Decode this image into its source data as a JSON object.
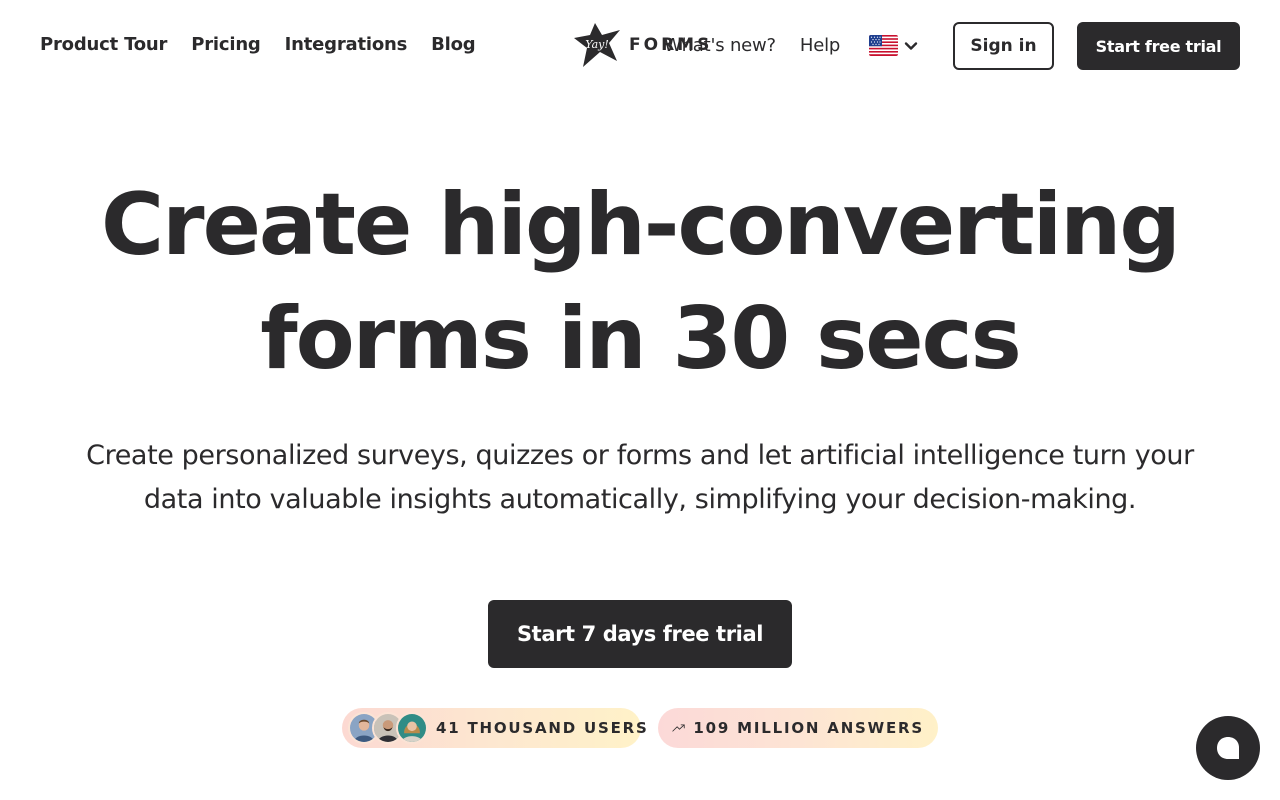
{
  "nav": {
    "left": [
      {
        "label": "Product Tour"
      },
      {
        "label": "Pricing"
      },
      {
        "label": "Integrations"
      },
      {
        "label": "Blog"
      }
    ],
    "logo": {
      "mark_text": "Yay!",
      "word": "FORMS"
    },
    "mid": [
      {
        "label": "What's new?"
      },
      {
        "label": "Help"
      }
    ],
    "language": {
      "flag": "us-flag-icon"
    },
    "sign_in": "Sign in",
    "start_trial": "Start free trial"
  },
  "hero": {
    "title_line1": "Create high-converting",
    "title_line2": "forms in 30 secs",
    "subtitle_line1": "Create personalized surveys, quizzes or forms and let artificial intelligence turn your",
    "subtitle_line2": "data into valuable insights automatically, simplifying your decision-making.",
    "cta": "Start 7 days free trial"
  },
  "stats": {
    "users": "41 THOUSAND USERS",
    "answers": "109 MILLION ANSWERS"
  },
  "colors": {
    "ink": "#2b2a2c",
    "background": "#ffffff",
    "badge_start": "#fcd9d2",
    "badge_end": "#fff2c8"
  }
}
